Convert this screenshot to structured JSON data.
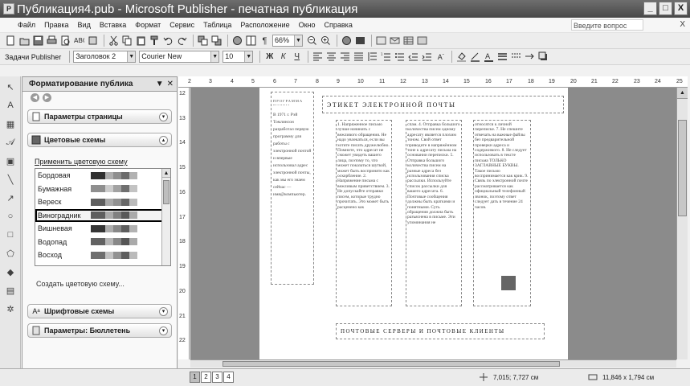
{
  "window": {
    "title": "Публикация4.pub - Microsoft Publisher - печатная публикация",
    "app_icon": "publisher-icon",
    "controls": [
      "_",
      "□",
      "X"
    ]
  },
  "menu": {
    "items": [
      "Файл",
      "Правка",
      "Вид",
      "Вставка",
      "Формат",
      "Сервис",
      "Таблица",
      "Расположение",
      "Окно",
      "Справка"
    ],
    "help_placeholder": "Введите вопрос",
    "close_doc": "X"
  },
  "toolbar1": {
    "zoom": "66%"
  },
  "toolbar2": {
    "tasks_label": "Задачи Publisher",
    "style": "Заголовок 2",
    "font": "Courier New",
    "size": "10"
  },
  "taskpane": {
    "title": "Форматирование публика",
    "sections": {
      "page_params": "Параметры страницы",
      "color_schemes": "Цветовые схемы",
      "font_schemes": "Шрифтовые схемы",
      "bulletin_params": "Параметры: Бюллетень"
    },
    "apply_title": "Применить цветовую схему",
    "schemes": [
      {
        "name": "Бордовая",
        "colors": [
          "#7a2030",
          "#c9a3a8",
          "#8e8e8e",
          "#6d6d6d",
          "#b0b0b0"
        ]
      },
      {
        "name": "Бумажная",
        "colors": [
          "#b08a50",
          "#d8c8a0",
          "#a0a0a0",
          "#707070",
          "#c0c0c0"
        ]
      },
      {
        "name": "Вереск",
        "colors": [
          "#705878",
          "#b8a0c0",
          "#909090",
          "#686868",
          "#b8b8b8"
        ]
      },
      {
        "name": "Виноградник",
        "colors": [
          "#4a6a3a",
          "#9ab080",
          "#808080",
          "#5a5a5a",
          "#a8a8a8"
        ]
      },
      {
        "name": "Вишневая",
        "colors": [
          "#902030",
          "#d0a0a8",
          "#888888",
          "#606060",
          "#b0b0b0"
        ]
      },
      {
        "name": "Водопад",
        "colors": [
          "#3a6a98",
          "#98b8d8",
          "#888888",
          "#585858",
          "#a8a8a8"
        ]
      },
      {
        "name": "Восход",
        "colors": [
          "#c06020",
          "#e8b888",
          "#909090",
          "#606060",
          "#b8b8b8"
        ]
      }
    ],
    "selected_index": 3,
    "create_link": "Создать цветовую схему..."
  },
  "document": {
    "left_column_header": "ПРОГРАММА ПОЧТЫ",
    "left_column_text": "В 1971 г. Рэй Томлинсон разработал первую программу для работы с электронной почтой и впервые использовал адрес электронной почты, как мы его знаем сейчас — имя@компьютер.",
    "heading": "ЭТИКЕТ ЭЛЕКТРОННОЙ ПОЧТЫ",
    "col1": "1. Напряженное письмо лучше начинать с вежливого обращения. Не надо увлекаться, если вы хотите писать дружелюбно. Помните, что адресат не сможет увидеть вашего лица, поэтому то, что может показаться шуткой, может быть воспринято как оскорбление. 2. Напряжение письма с вежливым приветствием. 3. Не допускайте отправки писем, которые трудно прочитать. Это может быть расценено как",
    "col2": "спам. 4. Отправка большого количества писем одному адресату является плохим тоном. Свой ответ приводите в напряжённом тоне к адресату письма на основании переписки. 5. Отправка большого количества писем на разные адреса без использования списка рассылки. Используйте список рассылки для вашего адресата. 6. Почтовые сообщения должны быть краткими и понятными. Суть обращения должна быть разъяснена в письме. Эти упоминания не",
    "col3": "относятся к личной переписке. 7. Не спешите отвечать на важные файлы без предварительной проверки адреса и содержимого. 8. Не следует использовать в тексте письма ТОЛЬКО ЗАГЛАВНЫЕ БУКВЫ. Такое письмо воспринимается как крик. 9. Связь по электронной почте рассматривается как официальный телефонный звонок, поэтому ответ следует дать в течение 24 часов.",
    "bottom_heading": "ПОЧТОВЫЕ СЕРВЕРЫ И ПОЧТОВЫЕ КЛИЕНТЫ"
  },
  "ruler": {
    "h_marks": [
      "2",
      "3",
      "4",
      "5",
      "6",
      "7",
      "8",
      "9",
      "10",
      "11",
      "12",
      "13",
      "14",
      "15",
      "16",
      "17",
      "18",
      "19",
      "20",
      "21",
      "22",
      "23",
      "24",
      "25"
    ],
    "v_marks": [
      "12",
      "13",
      "14",
      "15",
      "16",
      "17",
      "18",
      "19",
      "20",
      "21",
      "22"
    ]
  },
  "status": {
    "pages": [
      "1",
      "2",
      "3",
      "4"
    ],
    "active_page": "1",
    "position": "7,015; 7,727 см",
    "size": "11,846 x 1,794 см"
  }
}
